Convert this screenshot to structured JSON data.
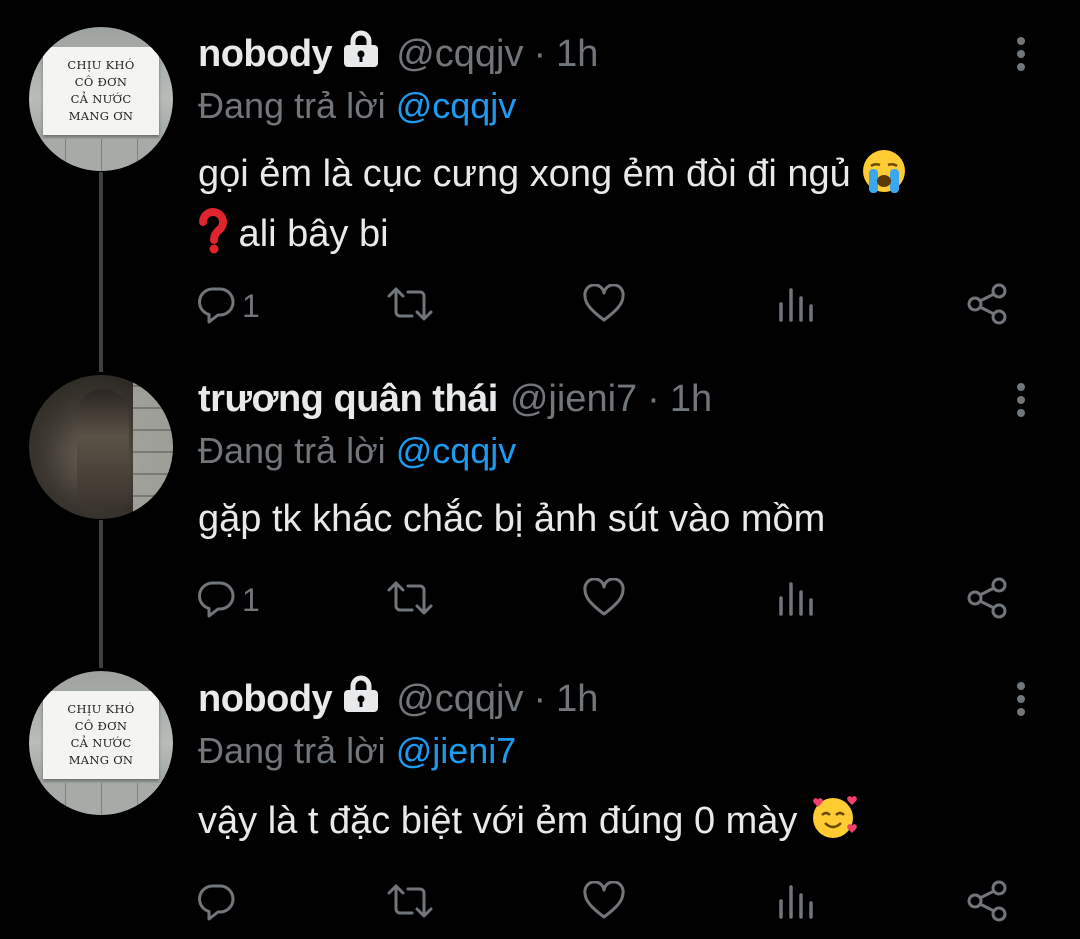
{
  "tweets": [
    {
      "name": "nobody",
      "handle": "@cqqjv",
      "separator": "·",
      "time": "1h",
      "reply_prefix": "Đang trả lời ",
      "reply_to": "@cqqjv",
      "text_line1": "gọi ẻm là cục cưng xong ẻm đòi đi ngủ",
      "text_line2": " ali bây bi",
      "emoji1": "crying-face",
      "emoji2": "red-question-mark",
      "reply_count": "1",
      "locked": true,
      "avatar": {
        "type": "sign",
        "lines": [
          "CHỊU KHÓ",
          "CÔ ĐƠN",
          "CẢ NƯỚC",
          "MANG ƠN"
        ]
      }
    },
    {
      "name": "trương quân thái",
      "handle": "@jieni7",
      "separator": "·",
      "time": "1h",
      "reply_prefix": "Đang trả lời ",
      "reply_to": "@cqqjv",
      "text_line1": "gặp tk khác chắc bị ảnh sút vào mồm",
      "reply_count": "1",
      "locked": false,
      "avatar": {
        "type": "photo"
      }
    },
    {
      "name": "nobody",
      "handle": "@cqqjv",
      "separator": "·",
      "time": "1h",
      "reply_prefix": "Đang trả lời ",
      "reply_to": "@jieni7",
      "text_line1": "vậy là t đặc biệt với ẻm đúng 0 mày",
      "emoji1": "smiling-face-with-hearts",
      "reply_count": "",
      "locked": true,
      "avatar": {
        "type": "sign",
        "lines": [
          "CHỊU KHÓ",
          "CÔ ĐƠN",
          "CẢ NƯỚC",
          "MANG ƠN"
        ]
      }
    }
  ],
  "colors": {
    "background": "#000000",
    "text": "#e7e9ea",
    "secondary": "#71767b",
    "mention": "#1d9bf0",
    "thread_line": "#3e4144"
  },
  "icons": [
    "lock-icon",
    "more-icon",
    "reply-icon",
    "retweet-icon",
    "like-icon",
    "views-icon",
    "share-icon"
  ]
}
